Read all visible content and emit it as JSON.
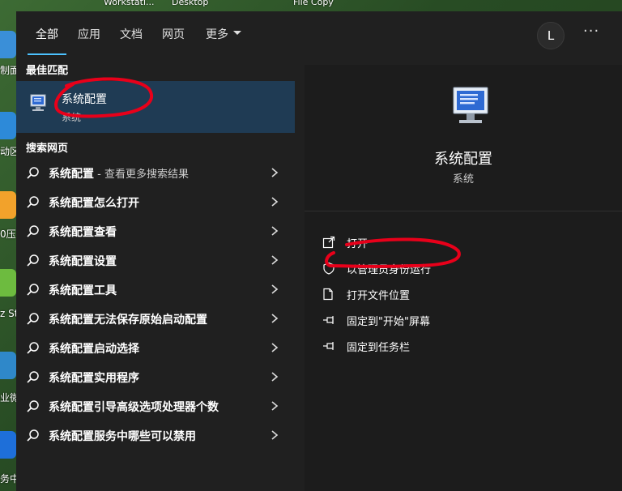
{
  "desktop": {
    "top_labels": [
      "Workstati...",
      "Desktop",
      "File Copy"
    ],
    "side_labels": [
      "制面",
      "动区",
      "0压",
      "z St",
      "业微",
      "务中心"
    ]
  },
  "tabs": [
    {
      "label": "全部",
      "active": true
    },
    {
      "label": "应用",
      "active": false
    },
    {
      "label": "文档",
      "active": false
    },
    {
      "label": "网页",
      "active": false
    },
    {
      "label": "更多",
      "active": false
    }
  ],
  "account": {
    "initial": "L"
  },
  "more_menu": "···",
  "best_match": {
    "section": "最佳匹配",
    "name": "系统配置",
    "type": "系统"
  },
  "web": {
    "section": "搜索网页",
    "results": [
      {
        "label": "系统配置",
        "suffix": " - 查看更多搜索结果"
      },
      {
        "label": "系统配置怎么打开",
        "suffix": ""
      },
      {
        "label": "系统配置查看",
        "suffix": ""
      },
      {
        "label": "系统配置设置",
        "suffix": ""
      },
      {
        "label": "系统配置工具",
        "suffix": ""
      },
      {
        "label": "系统配置无法保存原始启动配置",
        "suffix": ""
      },
      {
        "label": "系统配置启动选择",
        "suffix": ""
      },
      {
        "label": "系统配置实用程序",
        "suffix": ""
      },
      {
        "label": "系统配置引导高级选项处理器个数",
        "suffix": ""
      },
      {
        "label": "系统配置服务中哪些可以禁用",
        "suffix": ""
      }
    ]
  },
  "detail": {
    "title": "系统配置",
    "subtitle": "系统",
    "actions": [
      {
        "label": "打开",
        "icon": "open-icon"
      },
      {
        "label": "以管理员身份运行",
        "icon": "shield-icon"
      },
      {
        "label": "打开文件位置",
        "icon": "folder-icon"
      },
      {
        "label": "固定到\"开始\"屏幕",
        "icon": "pin-icon"
      },
      {
        "label": "固定到任务栏",
        "icon": "pin-icon"
      }
    ]
  },
  "colors": {
    "panel": "#202020",
    "detail_pane": "#1c1c1c",
    "selected": "#1f3b54",
    "accent": "#4cc2ff",
    "annotation": "#e8001a"
  }
}
